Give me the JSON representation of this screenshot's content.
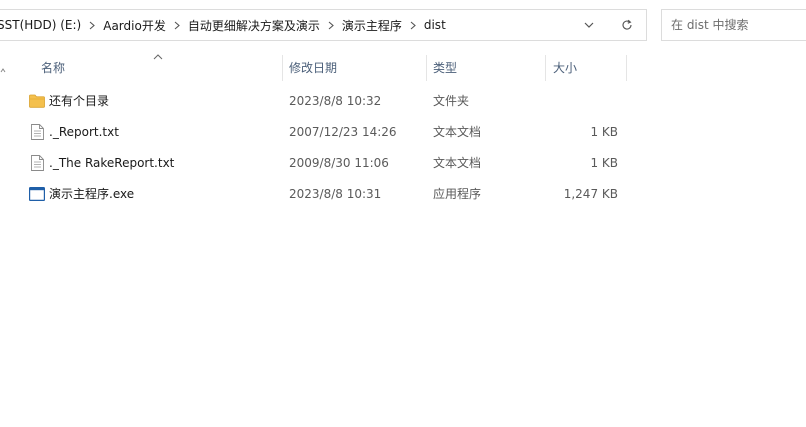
{
  "address_bar": {
    "crumbs": [
      "SST(HDD) (E:)",
      "Aardio开发",
      "自动更细解决方案及演示",
      "演示主程序",
      "dist"
    ]
  },
  "search": {
    "placeholder": "在 dist 中搜索"
  },
  "columns": {
    "name": "名称",
    "date": "修改日期",
    "type": "类型",
    "size": "大小"
  },
  "files": [
    {
      "name": "还有个目录",
      "date": "2023/8/8 10:32",
      "type": "文件夹",
      "size": "",
      "icon": "folder-icon"
    },
    {
      "name": "._Report.txt",
      "date": "2007/12/23 14:26",
      "type": "文本文档",
      "size": "1 KB",
      "icon": "text-file-icon"
    },
    {
      "name": "._The RakeReport.txt",
      "date": "2009/8/30 11:06",
      "type": "文本文档",
      "size": "1 KB",
      "icon": "text-file-icon"
    },
    {
      "name": "演示主程序.exe",
      "date": "2023/8/8 10:31",
      "type": "应用程序",
      "size": "1,247 KB",
      "icon": "exe-file-icon"
    }
  ],
  "colors": {
    "folder": "#f4c04d",
    "exe_frame": "#1f5fa8",
    "header_text": "#4c607a"
  }
}
